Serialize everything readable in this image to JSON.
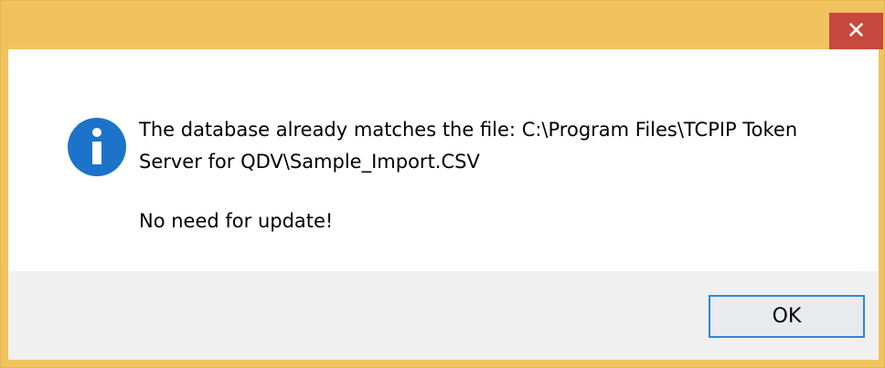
{
  "dialog": {
    "close_glyph": "✕",
    "close_icon": "close-icon",
    "info_icon": "information-icon",
    "message": {
      "line1": "The database already matches the file: C:\\Program Files\\TCPIP Token",
      "line2": "Server for QDV\\Sample_Import.CSV",
      "line3": "No need for update!"
    },
    "ok_label": "OK"
  },
  "colors": {
    "title_bar": "#f0c35e",
    "close_button": "#c7483d",
    "info_blue": "#1c73c9",
    "button_focus": "#2f86d8",
    "footer": "#f0f0f0"
  }
}
